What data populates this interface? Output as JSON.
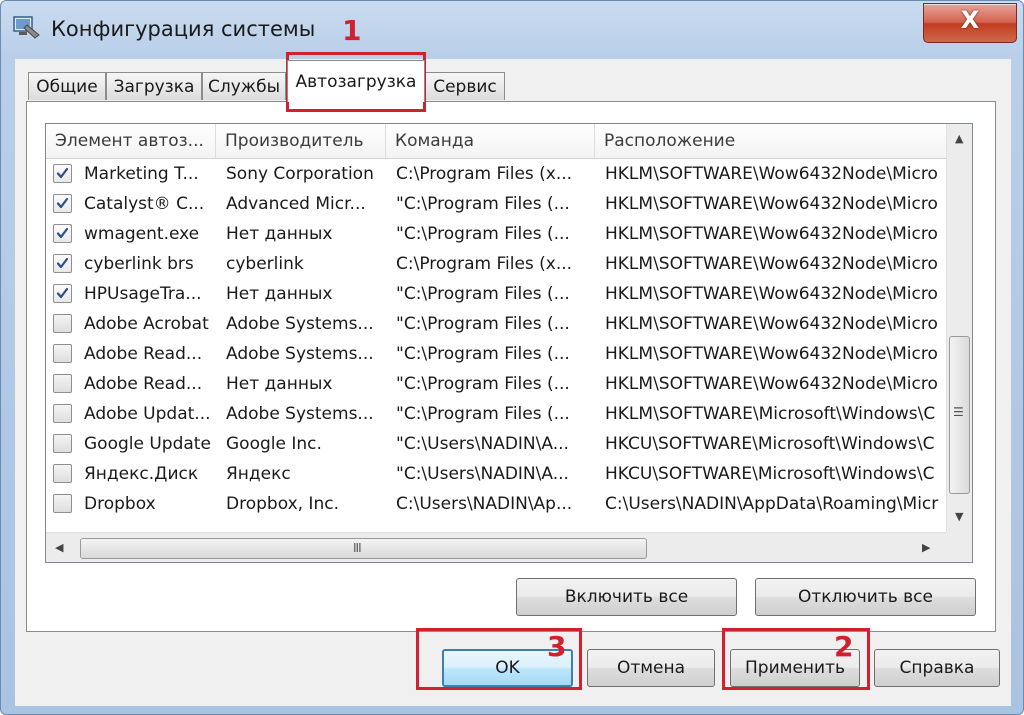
{
  "window": {
    "title": "Конфигурация системы",
    "close_glyph": "X"
  },
  "tabs": [
    {
      "label": "Общие"
    },
    {
      "label": "Загрузка"
    },
    {
      "label": "Службы"
    },
    {
      "label": "Автозагрузка",
      "selected": true
    },
    {
      "label": "Сервис"
    }
  ],
  "table": {
    "columns": [
      "Элемент автоз...",
      "Производитель",
      "Команда",
      "Расположение"
    ],
    "rows": [
      {
        "checked": true,
        "item": "Marketing T...",
        "maker": "Sony Corporation",
        "command": "C:\\Program Files (x...",
        "location": "HKLM\\SOFTWARE\\Wow6432Node\\Micro"
      },
      {
        "checked": true,
        "item": "Catalyst® C...",
        "maker": "Advanced Micr...",
        "command": "\"C:\\Program Files (...",
        "location": "HKLM\\SOFTWARE\\Wow6432Node\\Micro"
      },
      {
        "checked": true,
        "item": "wmagent.exe",
        "maker": "Нет данных",
        "command": "\"C:\\Program Files (...",
        "location": "HKLM\\SOFTWARE\\Wow6432Node\\Micro"
      },
      {
        "checked": true,
        "item": "cyberlink brs",
        "maker": "cyberlink",
        "command": "C:\\Program Files (x...",
        "location": "HKLM\\SOFTWARE\\Wow6432Node\\Micro"
      },
      {
        "checked": true,
        "item": "HPUsageTra...",
        "maker": "Нет данных",
        "command": "\"C:\\Program Files (...",
        "location": "HKLM\\SOFTWARE\\Wow6432Node\\Micro"
      },
      {
        "checked": false,
        "item": "Adobe Acrobat",
        "maker": "Adobe Systems...",
        "command": "\"C:\\Program Files (...",
        "location": "HKLM\\SOFTWARE\\Wow6432Node\\Micro"
      },
      {
        "checked": false,
        "item": "Adobe Read...",
        "maker": "Adobe Systems...",
        "command": "\"C:\\Program Files (...",
        "location": "HKLM\\SOFTWARE\\Wow6432Node\\Micro"
      },
      {
        "checked": false,
        "item": "Adobe Read...",
        "maker": "Нет данных",
        "command": "\"C:\\Program Files (...",
        "location": "HKLM\\SOFTWARE\\Wow6432Node\\Micro"
      },
      {
        "checked": false,
        "item": "Adobe Updat...",
        "maker": "Adobe Systems...",
        "command": "\"C:\\Program Files (...",
        "location": "HKLM\\SOFTWARE\\Microsoft\\Windows\\C"
      },
      {
        "checked": false,
        "item": "Google Update",
        "maker": "Google Inc.",
        "command": "\"C:\\Users\\NADIN\\A...",
        "location": "HKCU\\SOFTWARE\\Microsoft\\Windows\\C"
      },
      {
        "checked": false,
        "item": "Яндекс.Диск",
        "maker": "Яндекс",
        "command": "\"C:\\Users\\NADIN\\A...",
        "location": "HKCU\\SOFTWARE\\Microsoft\\Windows\\C"
      },
      {
        "checked": false,
        "item": "Dropbox",
        "maker": "Dropbox, Inc.",
        "command": "C:\\Users\\NADIN\\Ap...",
        "location": "C:\\Users\\NADIN\\AppData\\Roaming\\Micr"
      }
    ]
  },
  "buttons": {
    "enable_all": "Включить все",
    "disable_all": "Отключить все",
    "ok": "OK",
    "cancel": "Отмена",
    "apply": "Применить",
    "help": "Справка"
  },
  "annotations": {
    "marker_1": "1",
    "marker_2": "2",
    "marker_3": "3",
    "color": "#d1202f"
  },
  "scrollbar_glyphs": {
    "up": "▲",
    "down": "▼",
    "left": "◀",
    "right": "▶",
    "v_grip": "☰",
    "h_grip": "III"
  }
}
